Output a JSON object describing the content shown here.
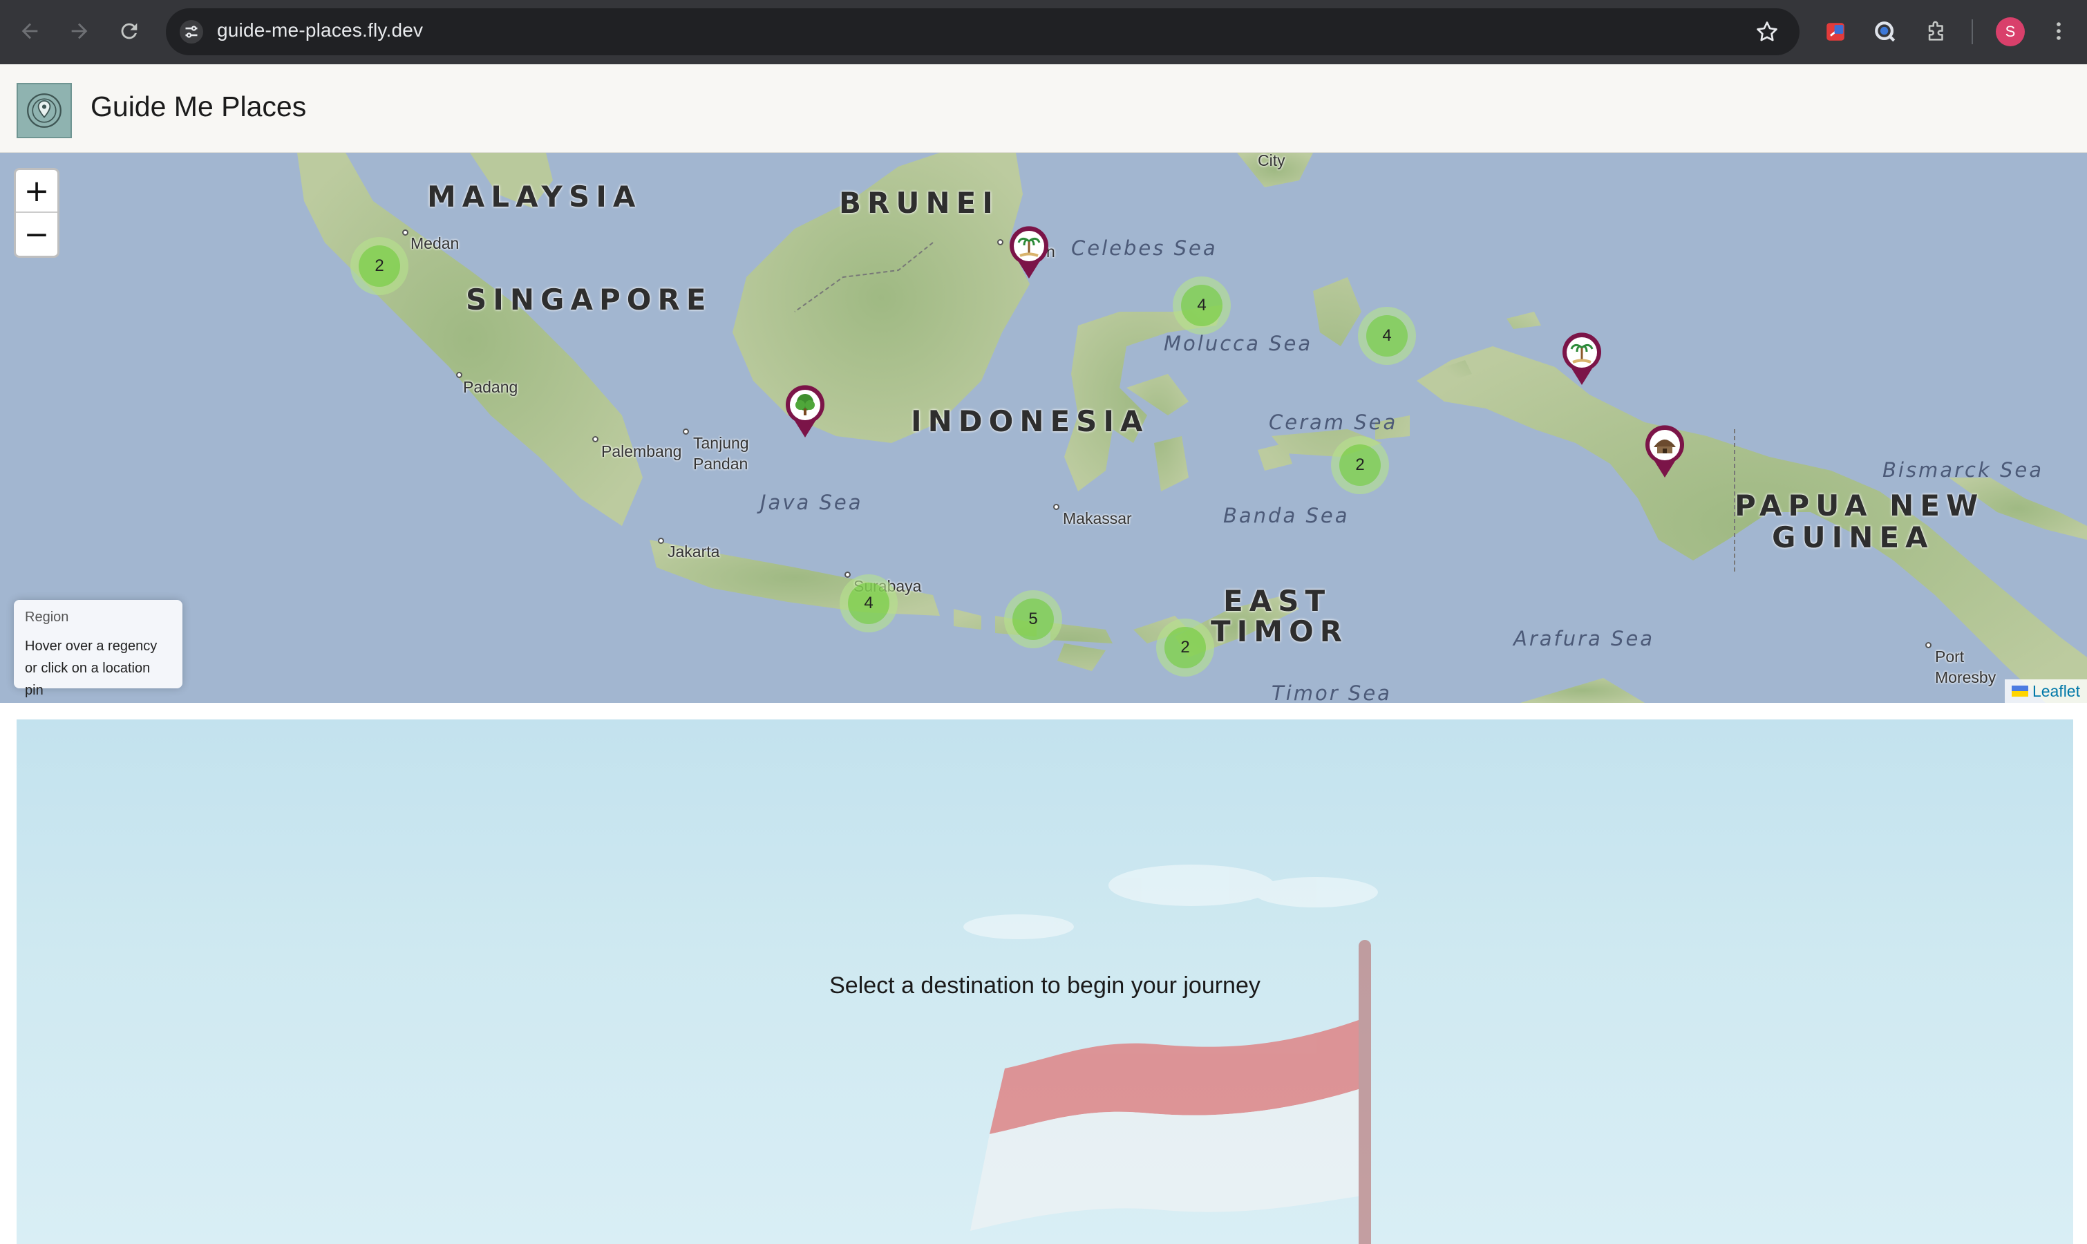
{
  "browser": {
    "url": "guide-me-places.fly.dev",
    "profile_initial": "S"
  },
  "app": {
    "title": "Guide Me Places",
    "logo_icon": "location-pin-logo"
  },
  "map": {
    "zoom_in_label": "+",
    "zoom_out_label": "−",
    "countries": {
      "malaysia": "MALAYSIA",
      "brunei": "BRUNEI",
      "singapore": "SINGAPORE",
      "indonesia": "INDONESIA",
      "east_timor_1": "EAST",
      "east_timor_2": "TIMOR",
      "png_1": "PAPUA NEW",
      "png_2": "GUINEA"
    },
    "seas": {
      "celebes": "Celebes Sea",
      "molucca": "Molucca Sea",
      "ceram": "Ceram Sea",
      "java": "Java Sea",
      "banda": "Banda Sea",
      "bismarck": "Bismarck Sea",
      "arafura": "Arafura Sea",
      "timor": "Timor Sea"
    },
    "cities": {
      "medan": "Medan",
      "padang": "Padang",
      "palembang": "Palembang",
      "tanjung_1": "Tanjung",
      "tanjung_2": "Pandan",
      "jakarta": "Jakarta",
      "surabaya": "Surabaya",
      "makassar": "Makassar",
      "port_1": "Port",
      "port_2": "Moresby",
      "city_top": "City",
      "tarakan_fragment": "n"
    },
    "clusters": {
      "sumatra": "2",
      "sulawesi_north": "4",
      "halmahera": "4",
      "seram": "2",
      "java": "4",
      "bali_lombok": "5",
      "timor": "2"
    },
    "pins": {
      "tarakan": "palm-tree-icon",
      "kalimantan": "tree-icon",
      "raja_ampat": "palm-tree-icon",
      "papua": "hut-icon"
    },
    "region_box": {
      "title": "Region",
      "line1": "Hover over a regency",
      "line2": "or click on a location pin"
    },
    "attribution": "Leaflet"
  },
  "hero": {
    "message": "Select a destination to begin your journey"
  },
  "colors": {
    "chrome_bg": "#35363a",
    "header_bg": "#f8f7f4",
    "sea": "#a2b6d0",
    "land": "#b7c79a",
    "pin": "#7b1448",
    "cluster_outer": "#b5e28c",
    "cluster_inner": "#6ecc39"
  }
}
